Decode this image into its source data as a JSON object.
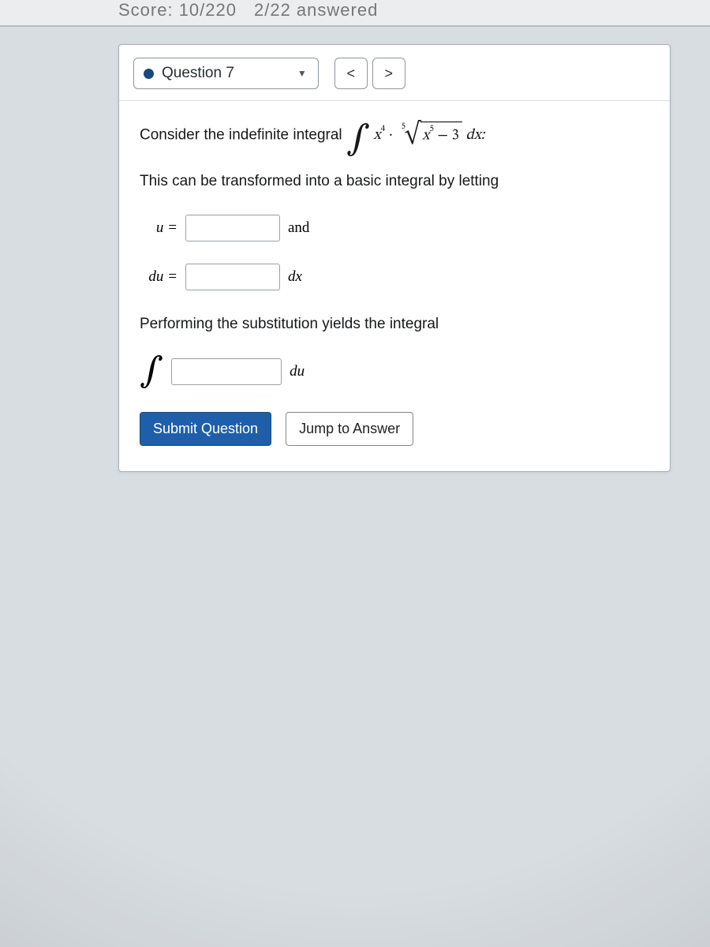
{
  "header": {
    "score_text": "Score: 10/220",
    "answered_text": "2/22 answered"
  },
  "navigator": {
    "question_label": "Question 7",
    "prev_glyph": "<",
    "next_glyph": ">"
  },
  "body": {
    "prompt_prefix": "Consider the indefinite integral ",
    "integral_base": "x",
    "integral_exp": "4",
    "dot": "·",
    "root_degree": "5",
    "radicand_base": "x",
    "radicand_exp": "5",
    "radicand_tail": " − 3",
    "dx_tail": " dx:",
    "line2": "This can be transformed into a basic integral by letting",
    "u_label": "u =",
    "and_label": "and",
    "du_label": "du =",
    "dx_label": "dx",
    "line3": "Performing the substitution yields the integral",
    "int_sym": "∫",
    "du_tail": "du"
  },
  "buttons": {
    "submit": "Submit Question",
    "jump": "Jump to Answer"
  }
}
